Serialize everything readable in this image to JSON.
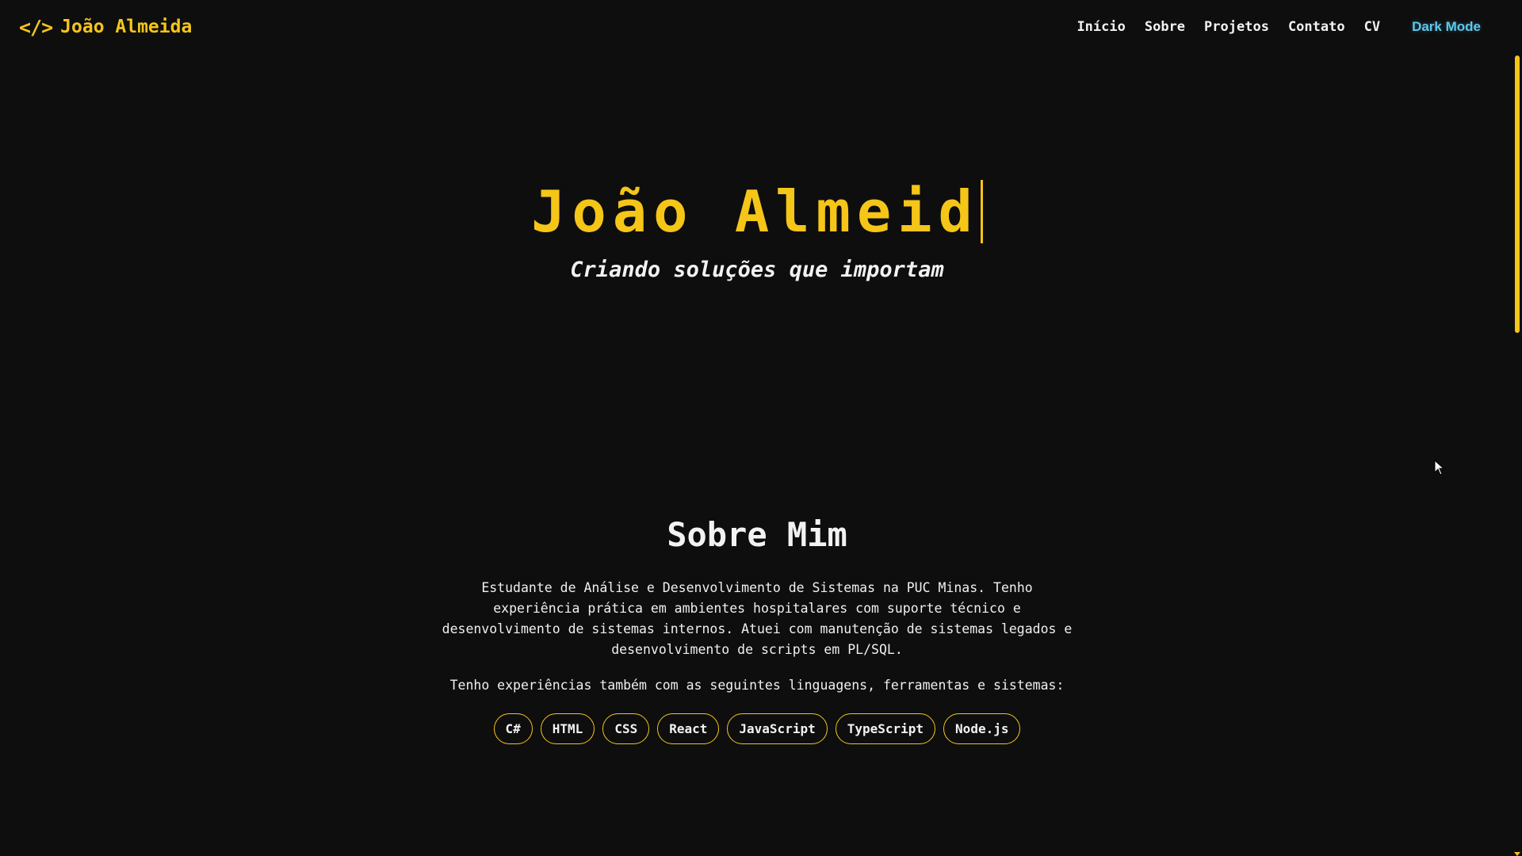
{
  "nav": {
    "brand_icon": "</>",
    "brand_name": "João Almeida",
    "links": [
      "Início",
      "Sobre",
      "Projetos",
      "Contato",
      "CV"
    ],
    "theme_toggle": "Dark Mode"
  },
  "hero": {
    "title": "João Almeid",
    "subtitle": "Criando soluções que importam"
  },
  "about": {
    "title": "Sobre Mim",
    "paragraph": "Estudante de Análise e Desenvolvimento de Sistemas na PUC Minas. Tenho experiência prática em ambientes hospitalares com suporte técnico e desenvolvimento de sistemas internos. Atuei com manutenção de sistemas legados e desenvolvimento de scripts em PL/SQL.",
    "skills_intro": "Tenho experiências também com as seguintes linguagens, ferramentas e sistemas:",
    "skills": [
      "C#",
      "HTML",
      "CSS",
      "React",
      "JavaScript",
      "TypeScript",
      "Node.js"
    ]
  },
  "colors": {
    "background": "#0e0e0f",
    "accent": "#f5c518",
    "theme_toggle": "#5ec8ec",
    "text": "#f2f2f2"
  }
}
